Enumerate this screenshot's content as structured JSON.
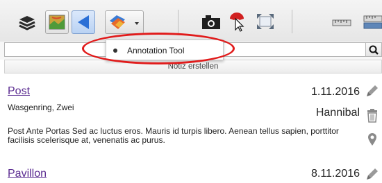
{
  "toolbar": {
    "buttons": [
      {
        "name": "layers-icon"
      },
      {
        "name": "map-icon"
      },
      {
        "name": "navigate-back-icon"
      },
      {
        "name": "annotation-dropdown-icon"
      },
      {
        "name": "camera-icon"
      },
      {
        "name": "pointer-icon"
      },
      {
        "name": "fullscreen-icon"
      },
      {
        "name": "ruler-icon"
      },
      {
        "name": "area-measure-icon"
      }
    ]
  },
  "dropdown": {
    "item_label": "Annotation Tool"
  },
  "search": {
    "value": "",
    "placeholder": ""
  },
  "create_note": {
    "label": "Notiz erstellen"
  },
  "notes": [
    {
      "title": "Post",
      "date": "1.11.2016",
      "location": "Wasgenring, Zwei",
      "author": "Hannibal",
      "text": "Post Ante Portas Sed ac luctus eros. Mauris id turpis libero. Aenean tellus sapien, porttitor facilisis scelerisque at, venenatis ac purus."
    },
    {
      "title": "Pavillon",
      "date": "8.11.2016"
    }
  ],
  "colors": {
    "accent_blue": "#2a6fd6",
    "link_purple": "#5b2c91",
    "highlight_red": "#e11b1b"
  }
}
